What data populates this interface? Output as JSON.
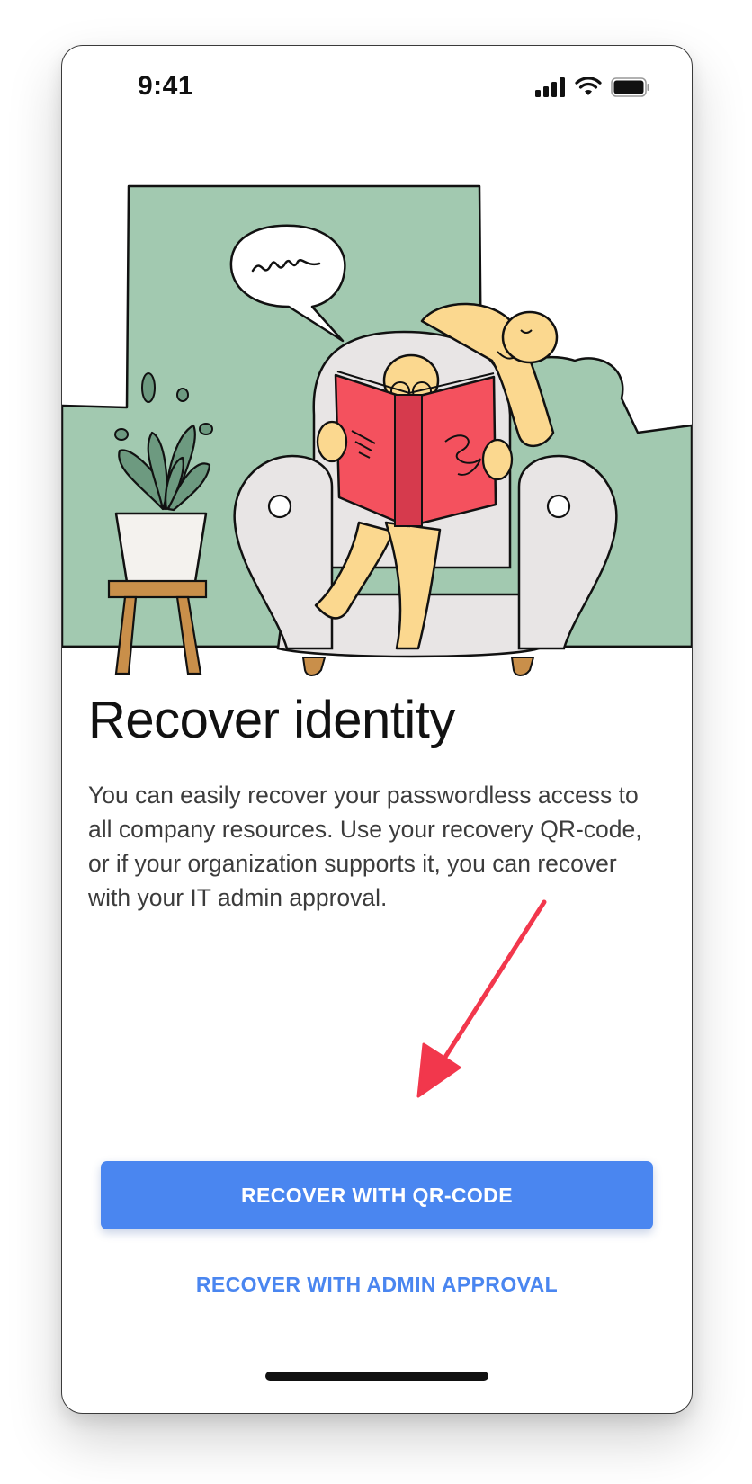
{
  "status_bar": {
    "time": "9:41",
    "icons": [
      "cellular-signal-icon",
      "wifi-icon",
      "battery-icon"
    ]
  },
  "illustration": {
    "subject": "person-reading-book-in-armchair",
    "colors": {
      "backdrop": "#a2c9b0",
      "armchair": "#e8e5e5",
      "book": "#f4515e",
      "skin": "#fbd88f",
      "legs": "#c98f4a"
    }
  },
  "content": {
    "title": "Recover identity",
    "description": "You can easily recover your passwordless access to all company resources. Use your recovery QR-code, or if your organization supports it, you can recover with your IT admin approval."
  },
  "actions": {
    "primary_label": "RECOVER WITH QR-CODE",
    "secondary_label": "RECOVER WITH ADMIN APPROVAL"
  },
  "annotation": {
    "type": "arrow",
    "color": "#f2374c",
    "points_to": "primary-button"
  },
  "colors": {
    "accent": "#4a86f0",
    "text": "#111111"
  }
}
